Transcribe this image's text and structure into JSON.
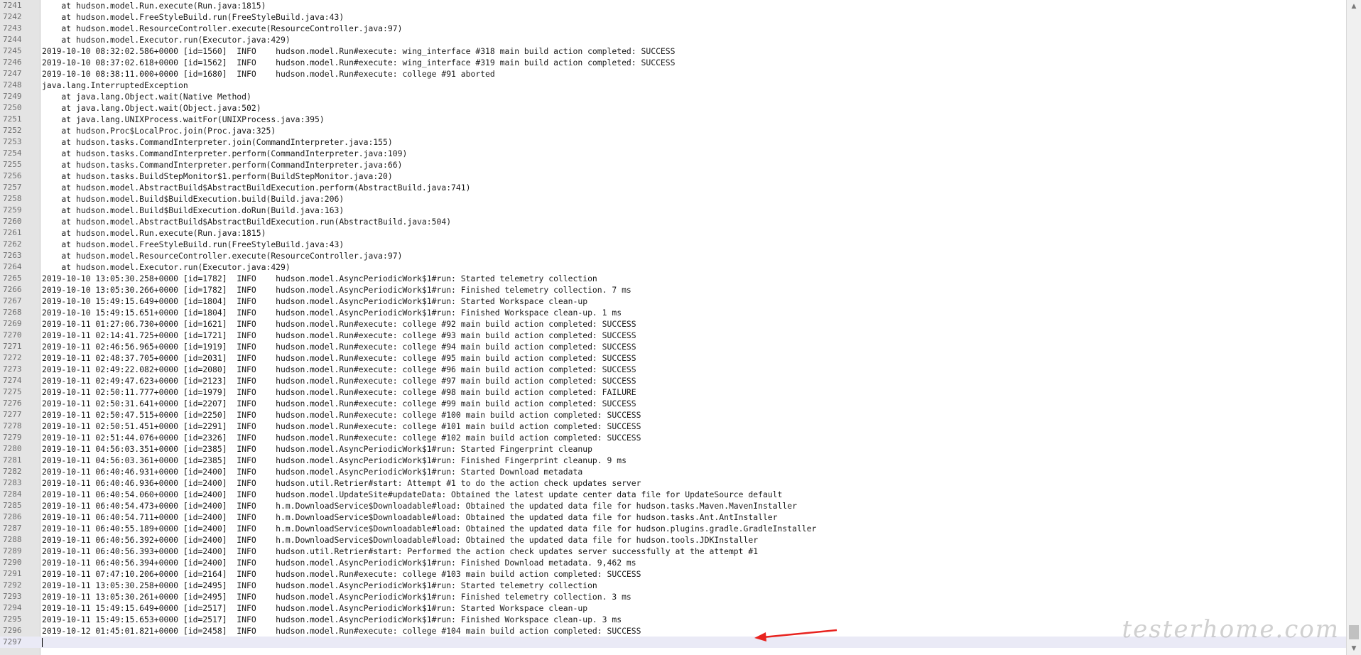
{
  "editor": {
    "lines": [
      {
        "n": "7241",
        "t": "    at hudson.model.Run.execute(Run.java:1815)"
      },
      {
        "n": "7242",
        "t": "    at hudson.model.FreeStyleBuild.run(FreeStyleBuild.java:43)"
      },
      {
        "n": "7243",
        "t": "    at hudson.model.ResourceController.execute(ResourceController.java:97)"
      },
      {
        "n": "7244",
        "t": "    at hudson.model.Executor.run(Executor.java:429)"
      },
      {
        "n": "7245",
        "t": "2019-10-10 08:32:02.586+0000 [id=1560]  INFO    hudson.model.Run#execute: wing_interface #318 main build action completed: SUCCESS"
      },
      {
        "n": "7246",
        "t": "2019-10-10 08:37:02.618+0000 [id=1562]  INFO    hudson.model.Run#execute: wing_interface #319 main build action completed: SUCCESS"
      },
      {
        "n": "7247",
        "t": "2019-10-10 08:38:11.000+0000 [id=1680]  INFO    hudson.model.Run#execute: college #91 aborted"
      },
      {
        "n": "7248",
        "t": "java.lang.InterruptedException"
      },
      {
        "n": "7249",
        "t": "    at java.lang.Object.wait(Native Method)"
      },
      {
        "n": "7250",
        "t": "    at java.lang.Object.wait(Object.java:502)"
      },
      {
        "n": "7251",
        "t": "    at java.lang.UNIXProcess.waitFor(UNIXProcess.java:395)"
      },
      {
        "n": "7252",
        "t": "    at hudson.Proc$LocalProc.join(Proc.java:325)"
      },
      {
        "n": "7253",
        "t": "    at hudson.tasks.CommandInterpreter.join(CommandInterpreter.java:155)"
      },
      {
        "n": "7254",
        "t": "    at hudson.tasks.CommandInterpreter.perform(CommandInterpreter.java:109)"
      },
      {
        "n": "7255",
        "t": "    at hudson.tasks.CommandInterpreter.perform(CommandInterpreter.java:66)"
      },
      {
        "n": "7256",
        "t": "    at hudson.tasks.BuildStepMonitor$1.perform(BuildStepMonitor.java:20)"
      },
      {
        "n": "7257",
        "t": "    at hudson.model.AbstractBuild$AbstractBuildExecution.perform(AbstractBuild.java:741)"
      },
      {
        "n": "7258",
        "t": "    at hudson.model.Build$BuildExecution.build(Build.java:206)"
      },
      {
        "n": "7259",
        "t": "    at hudson.model.Build$BuildExecution.doRun(Build.java:163)"
      },
      {
        "n": "7260",
        "t": "    at hudson.model.AbstractBuild$AbstractBuildExecution.run(AbstractBuild.java:504)"
      },
      {
        "n": "7261",
        "t": "    at hudson.model.Run.execute(Run.java:1815)"
      },
      {
        "n": "7262",
        "t": "    at hudson.model.FreeStyleBuild.run(FreeStyleBuild.java:43)"
      },
      {
        "n": "7263",
        "t": "    at hudson.model.ResourceController.execute(ResourceController.java:97)"
      },
      {
        "n": "7264",
        "t": "    at hudson.model.Executor.run(Executor.java:429)"
      },
      {
        "n": "7265",
        "t": "2019-10-10 13:05:30.258+0000 [id=1782]  INFO    hudson.model.AsyncPeriodicWork$1#run: Started telemetry collection"
      },
      {
        "n": "7266",
        "t": "2019-10-10 13:05:30.266+0000 [id=1782]  INFO    hudson.model.AsyncPeriodicWork$1#run: Finished telemetry collection. 7 ms"
      },
      {
        "n": "7267",
        "t": "2019-10-10 15:49:15.649+0000 [id=1804]  INFO    hudson.model.AsyncPeriodicWork$1#run: Started Workspace clean-up"
      },
      {
        "n": "7268",
        "t": "2019-10-10 15:49:15.651+0000 [id=1804]  INFO    hudson.model.AsyncPeriodicWork$1#run: Finished Workspace clean-up. 1 ms"
      },
      {
        "n": "7269",
        "t": "2019-10-11 01:27:06.730+0000 [id=1621]  INFO    hudson.model.Run#execute: college #92 main build action completed: SUCCESS"
      },
      {
        "n": "7270",
        "t": "2019-10-11 02:14:41.725+0000 [id=1721]  INFO    hudson.model.Run#execute: college #93 main build action completed: SUCCESS"
      },
      {
        "n": "7271",
        "t": "2019-10-11 02:46:56.965+0000 [id=1919]  INFO    hudson.model.Run#execute: college #94 main build action completed: SUCCESS"
      },
      {
        "n": "7272",
        "t": "2019-10-11 02:48:37.705+0000 [id=2031]  INFO    hudson.model.Run#execute: college #95 main build action completed: SUCCESS"
      },
      {
        "n": "7273",
        "t": "2019-10-11 02:49:22.082+0000 [id=2080]  INFO    hudson.model.Run#execute: college #96 main build action completed: SUCCESS"
      },
      {
        "n": "7274",
        "t": "2019-10-11 02:49:47.623+0000 [id=2123]  INFO    hudson.model.Run#execute: college #97 main build action completed: SUCCESS"
      },
      {
        "n": "7275",
        "t": "2019-10-11 02:50:11.777+0000 [id=1979]  INFO    hudson.model.Run#execute: college #98 main build action completed: FAILURE"
      },
      {
        "n": "7276",
        "t": "2019-10-11 02:50:31.641+0000 [id=2207]  INFO    hudson.model.Run#execute: college #99 main build action completed: SUCCESS"
      },
      {
        "n": "7277",
        "t": "2019-10-11 02:50:47.515+0000 [id=2250]  INFO    hudson.model.Run#execute: college #100 main build action completed: SUCCESS"
      },
      {
        "n": "7278",
        "t": "2019-10-11 02:50:51.451+0000 [id=2291]  INFO    hudson.model.Run#execute: college #101 main build action completed: SUCCESS"
      },
      {
        "n": "7279",
        "t": "2019-10-11 02:51:44.076+0000 [id=2326]  INFO    hudson.model.Run#execute: college #102 main build action completed: SUCCESS"
      },
      {
        "n": "7280",
        "t": "2019-10-11 04:56:03.351+0000 [id=2385]  INFO    hudson.model.AsyncPeriodicWork$1#run: Started Fingerprint cleanup"
      },
      {
        "n": "7281",
        "t": "2019-10-11 04:56:03.361+0000 [id=2385]  INFO    hudson.model.AsyncPeriodicWork$1#run: Finished Fingerprint cleanup. 9 ms"
      },
      {
        "n": "7282",
        "t": "2019-10-11 06:40:46.931+0000 [id=2400]  INFO    hudson.model.AsyncPeriodicWork$1#run: Started Download metadata"
      },
      {
        "n": "7283",
        "t": "2019-10-11 06:40:46.936+0000 [id=2400]  INFO    hudson.util.Retrier#start: Attempt #1 to do the action check updates server"
      },
      {
        "n": "7284",
        "t": "2019-10-11 06:40:54.060+0000 [id=2400]  INFO    hudson.model.UpdateSite#updateData: Obtained the latest update center data file for UpdateSource default"
      },
      {
        "n": "7285",
        "t": "2019-10-11 06:40:54.473+0000 [id=2400]  INFO    h.m.DownloadService$Downloadable#load: Obtained the updated data file for hudson.tasks.Maven.MavenInstaller"
      },
      {
        "n": "7286",
        "t": "2019-10-11 06:40:54.711+0000 [id=2400]  INFO    h.m.DownloadService$Downloadable#load: Obtained the updated data file for hudson.tasks.Ant.AntInstaller"
      },
      {
        "n": "7287",
        "t": "2019-10-11 06:40:55.189+0000 [id=2400]  INFO    h.m.DownloadService$Downloadable#load: Obtained the updated data file for hudson.plugins.gradle.GradleInstaller"
      },
      {
        "n": "7288",
        "t": "2019-10-11 06:40:56.392+0000 [id=2400]  INFO    h.m.DownloadService$Downloadable#load: Obtained the updated data file for hudson.tools.JDKInstaller"
      },
      {
        "n": "7289",
        "t": "2019-10-11 06:40:56.393+0000 [id=2400]  INFO    hudson.util.Retrier#start: Performed the action check updates server successfully at the attempt #1"
      },
      {
        "n": "7290",
        "t": "2019-10-11 06:40:56.394+0000 [id=2400]  INFO    hudson.model.AsyncPeriodicWork$1#run: Finished Download metadata. 9,462 ms"
      },
      {
        "n": "7291",
        "t": "2019-10-11 07:47:10.206+0000 [id=2164]  INFO    hudson.model.Run#execute: college #103 main build action completed: SUCCESS"
      },
      {
        "n": "7292",
        "t": "2019-10-11 13:05:30.258+0000 [id=2495]  INFO    hudson.model.AsyncPeriodicWork$1#run: Started telemetry collection"
      },
      {
        "n": "7293",
        "t": "2019-10-11 13:05:30.261+0000 [id=2495]  INFO    hudson.model.AsyncPeriodicWork$1#run: Finished telemetry collection. 3 ms"
      },
      {
        "n": "7294",
        "t": "2019-10-11 15:49:15.649+0000 [id=2517]  INFO    hudson.model.AsyncPeriodicWork$1#run: Started Workspace clean-up"
      },
      {
        "n": "7295",
        "t": "2019-10-11 15:49:15.653+0000 [id=2517]  INFO    hudson.model.AsyncPeriodicWork$1#run: Finished Workspace clean-up. 3 ms"
      },
      {
        "n": "7296",
        "t": "2019-10-12 01:45:01.821+0000 [id=2458]  INFO    hudson.model.Run#execute: college #104 main build action completed: SUCCESS"
      },
      {
        "n": "7297",
        "t": ""
      }
    ],
    "current_line": "7297"
  },
  "watermark": "testerhome.com",
  "colors": {
    "annotation_arrow": "#e8231f",
    "current_line_bg": "#eaeaf6",
    "gutter_bg": "#e4e4e4"
  }
}
